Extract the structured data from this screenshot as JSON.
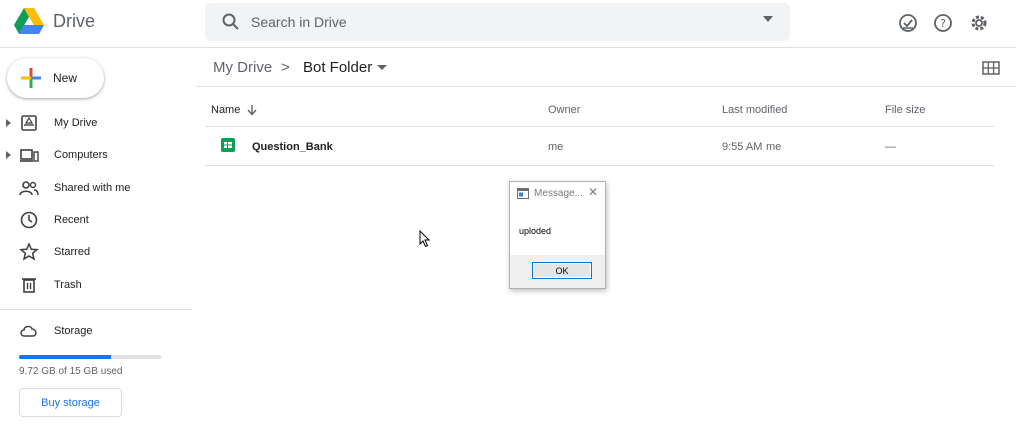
{
  "app": {
    "name": "Drive"
  },
  "search": {
    "placeholder": "Search in Drive"
  },
  "sidebar": {
    "new_label": "New",
    "items": [
      {
        "label": "My Drive",
        "icon": "my-drive-icon"
      },
      {
        "label": "Computers",
        "icon": "computers-icon"
      },
      {
        "label": "Shared with me",
        "icon": "shared-icon"
      },
      {
        "label": "Recent",
        "icon": "clock-icon"
      },
      {
        "label": "Starred",
        "icon": "star-icon"
      },
      {
        "label": "Trash",
        "icon": "trash-icon"
      }
    ],
    "storage": {
      "label": "Storage",
      "used_text": "9.72 GB of 15 GB used",
      "used_fraction": 0.648,
      "buy_label": "Buy storage"
    }
  },
  "breadcrumb": {
    "root": "My Drive",
    "separator": ">",
    "current": "Bot Folder"
  },
  "table": {
    "headers": {
      "name": "Name",
      "owner": "Owner",
      "modified": "Last modified",
      "size": "File size"
    },
    "rows": [
      {
        "name": "Question_Bank",
        "owner": "me",
        "modified": "9:55 AM",
        "modified_by": "me",
        "size": "—"
      }
    ]
  },
  "dialog": {
    "title": "Message...",
    "message": "uploded",
    "ok_label": "OK"
  },
  "colors": {
    "accent": "#1a73e8",
    "sheets_green": "#0f9d58"
  }
}
